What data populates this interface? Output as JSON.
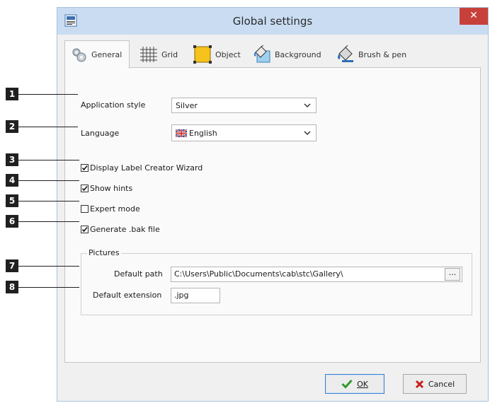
{
  "window": {
    "title": "Global settings",
    "close_glyph": "✕",
    "app_icon": "cab-logo-icon"
  },
  "tabs": [
    {
      "label": "General",
      "icon": "gears-icon",
      "active": true
    },
    {
      "label": "Grid",
      "icon": "grid-icon",
      "active": false
    },
    {
      "label": "Object",
      "icon": "object-frame-icon",
      "active": false
    },
    {
      "label": "Background",
      "icon": "paint-bucket-image-icon",
      "active": false
    },
    {
      "label": "Brush & pen",
      "icon": "paint-bucket-icon",
      "active": false
    }
  ],
  "general": {
    "app_style_label": "Application style",
    "app_style_value": "Silver",
    "language_label": "Language",
    "language_value": "English",
    "checkboxes": [
      {
        "label": "Display Label Creator Wizard",
        "checked": true
      },
      {
        "label": "Show hints",
        "checked": true
      },
      {
        "label": "Expert mode",
        "checked": false
      },
      {
        "label": "Generate .bak file",
        "checked": true
      }
    ],
    "pictures": {
      "group_label": "Pictures",
      "default_path_label": "Default path",
      "default_path_value": "C:\\Users\\Public\\Documents\\cab\\stc\\Gallery\\",
      "browse_label": "...",
      "default_ext_label": "Default extension",
      "default_ext_value": ".jpg"
    }
  },
  "footer": {
    "ok_label": "OK",
    "cancel_label": "Cancel"
  },
  "callouts": [
    "1",
    "2",
    "3",
    "4",
    "5",
    "6",
    "7",
    "8"
  ],
  "colors": {
    "titlebar": "#c9dcf2",
    "close": "#c7413a",
    "ok_check": "#2e9a2e",
    "cancel_x": "#c8201c",
    "callout": "#202020"
  }
}
